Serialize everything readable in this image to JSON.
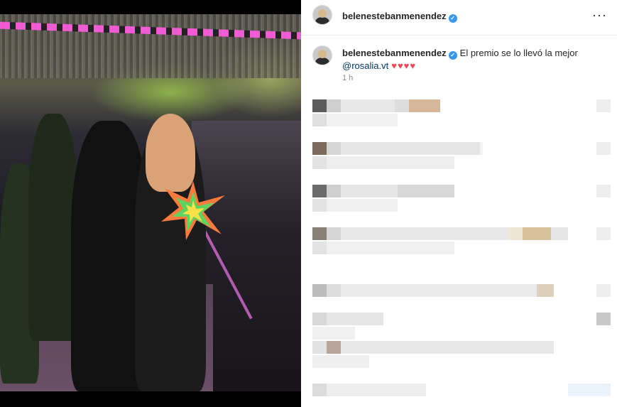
{
  "post": {
    "username": "belenestebanmenendez",
    "verified_mark": "✓",
    "more_icon": "···",
    "caption": {
      "username": "belenestebanmenendez",
      "text": "El premio se lo llevó la mejor",
      "mention": "@rosalia.vt",
      "hearts": "♥♥♥♥",
      "time": "1 h"
    }
  },
  "colors": {
    "verified": "#3897f0",
    "mention": "#00376b",
    "heart": "#ed4956",
    "muted": "#8e8e8e"
  },
  "icons": [
    "verified-badge-icon",
    "more-options-icon",
    "heart-icon"
  ]
}
